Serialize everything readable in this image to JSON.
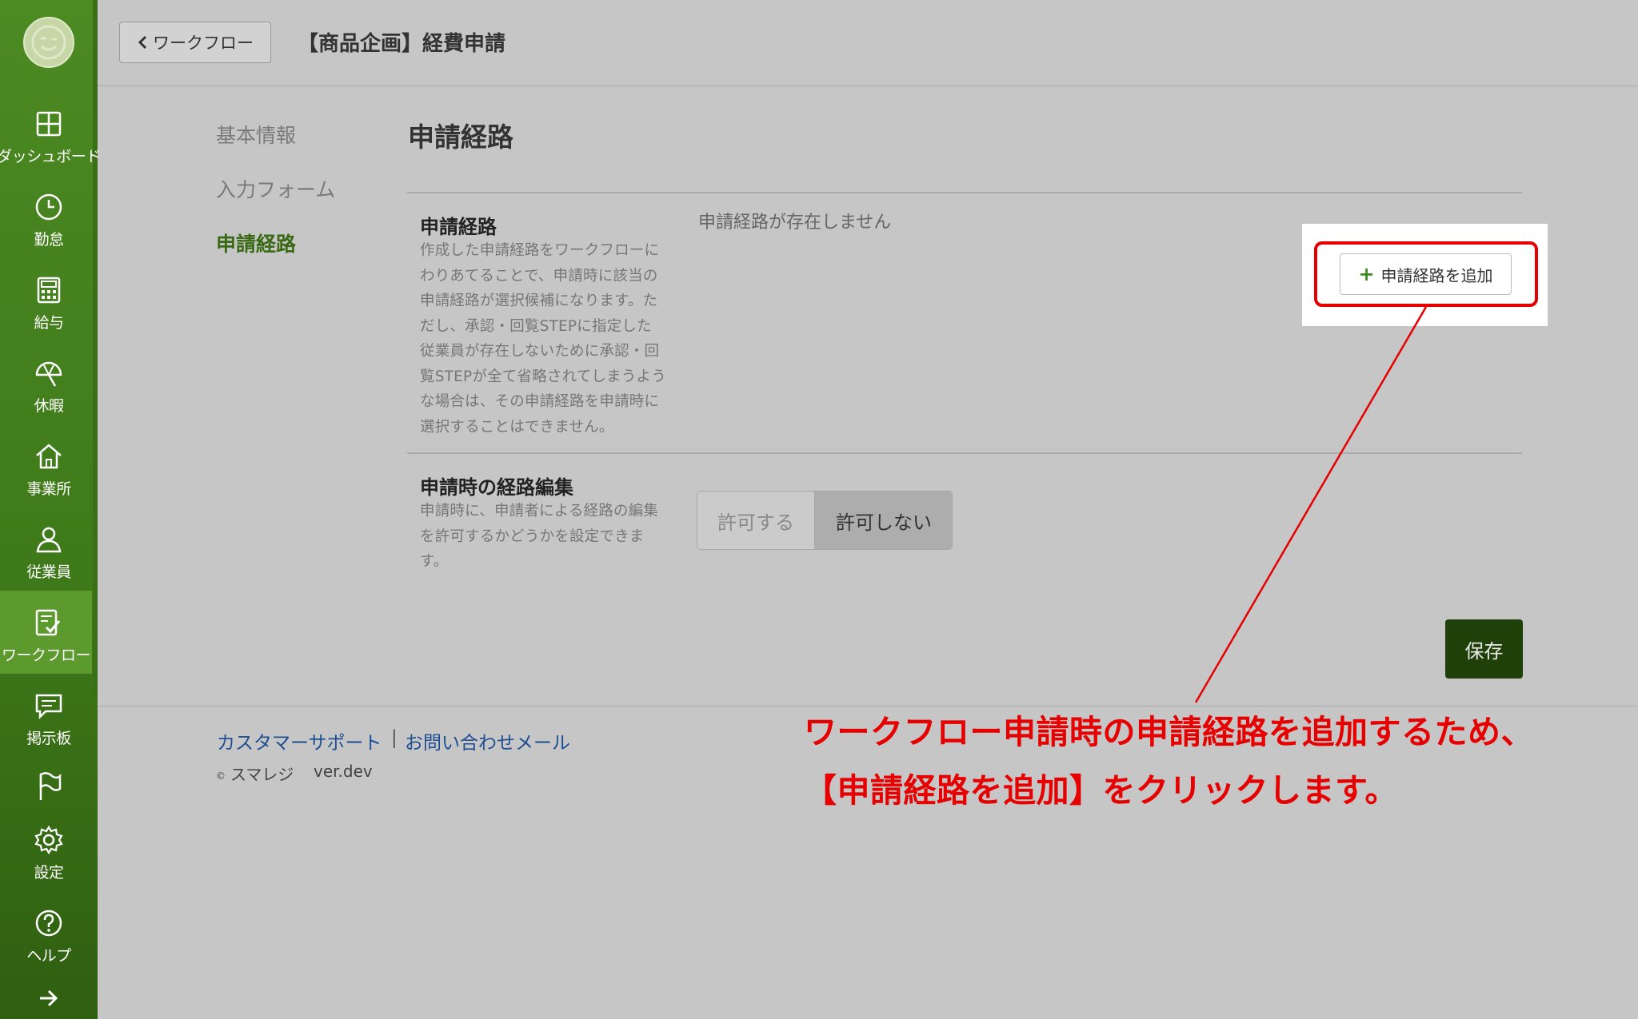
{
  "sidebar": {
    "items": [
      {
        "label": "ダッシュボード",
        "icon": "dashboard-icon"
      },
      {
        "label": "勤怠",
        "icon": "clock-icon"
      },
      {
        "label": "給与",
        "icon": "calculator-icon"
      },
      {
        "label": "休暇",
        "icon": "umbrella-icon"
      },
      {
        "label": "事業所",
        "icon": "home-icon"
      },
      {
        "label": "従業員",
        "icon": "person-icon"
      },
      {
        "label": "ワークフロー",
        "icon": "workflow-icon"
      },
      {
        "label": "掲示板",
        "icon": "chat-icon"
      },
      {
        "label": "",
        "icon": "flag-icon"
      },
      {
        "label": "設定",
        "icon": "gear-icon"
      },
      {
        "label": "ヘルプ",
        "icon": "help-icon"
      }
    ],
    "active_item": "ワークフロー",
    "expand_icon": "arrow-right-icon"
  },
  "header": {
    "back_label": "ワークフロー",
    "title": "【商品企画】経費申請"
  },
  "subnav": {
    "items": [
      "基本情報",
      "入力フォーム",
      "申請経路"
    ],
    "active": "申請経路"
  },
  "main": {
    "section_title": "申請経路",
    "route": {
      "label": "申請経路",
      "description_lines": [
        "作成した申請経路をワークフローに",
        "わりあてることで、申請時に該当の",
        "申請経路が選択候補になります。た",
        "だし、承認・回覧STEPに指定した",
        "従業員が存在しないために承認・回",
        "覧STEPが全て省略されてしまうよう",
        "な場合は、その申請経路を申請時に",
        "選択することはできません。"
      ],
      "empty_message": "申請経路が存在しません",
      "add_button_label": "申請経路を追加"
    },
    "route_edit": {
      "label": "申請時の経路編集",
      "description_lines": [
        "申請時に、申請者による経路の編集",
        "を許可するかどうかを設定できま",
        "す。"
      ],
      "options": [
        "許可する",
        "許可しない"
      ],
      "selected": "許可しない"
    },
    "save_label": "保存"
  },
  "footer": {
    "support_link": "カスタマーサポート",
    "separator": "|",
    "contact_link": "お問い合わせメール",
    "copyright_symbol": "©",
    "copyright": "スマレジ",
    "version": "ver.dev"
  },
  "annotation": {
    "line1": "ワークフロー申請時の申請経路を追加するため、",
    "line2": "【申請経路を追加】をクリックします。",
    "color": "#e60000"
  },
  "colors": {
    "sidebar": "#4c8a22",
    "active_subnav": "#3a6b14",
    "save_button": "#1f4008",
    "link": "#1e4f93"
  }
}
